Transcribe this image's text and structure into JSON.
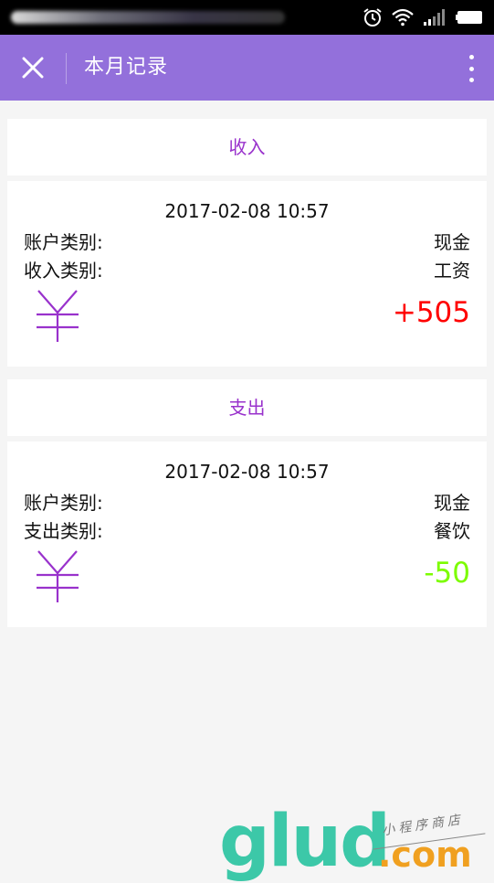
{
  "header": {
    "title": "本月记录"
  },
  "income": {
    "section_label": "收入",
    "record": {
      "time": "2017-02-08 10:57",
      "account_label": "账户类别:",
      "account_value": "现金",
      "type_label": "收入类别:",
      "type_value": "工资",
      "amount": "+505"
    }
  },
  "expense": {
    "section_label": "支出",
    "record": {
      "time": "2017-02-08 10:57",
      "account_label": "账户类别:",
      "account_value": "现金",
      "type_label": "支出类别:",
      "type_value": "餐饮",
      "amount": "-50"
    }
  },
  "watermark": {
    "brand": "glud",
    "domain": ".com",
    "tagline": "小程序商店"
  },
  "colors": {
    "nav_bg": "#9370db",
    "section_text": "#9932cc",
    "income_amount": "#ff0000",
    "expense_amount": "#7cfc00",
    "yen_icon": "#9932cc"
  },
  "icons": {
    "close": "close-icon",
    "more": "more-vertical-icon",
    "yen": "yen-icon",
    "alarm": "alarm-icon",
    "wifi": "wifi-icon",
    "signal": "signal-icon",
    "battery": "battery-icon"
  }
}
